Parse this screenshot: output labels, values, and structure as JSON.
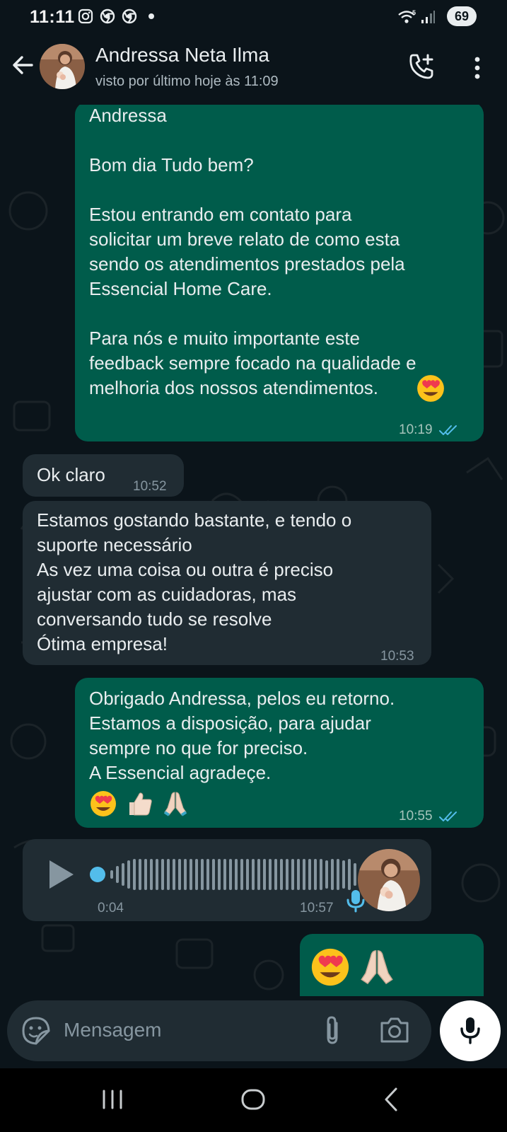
{
  "status_bar": {
    "time": "11:11",
    "battery": "69"
  },
  "header": {
    "contact_name": "Andressa Neta Ilma",
    "last_seen": "visto por último hoje às 11:09"
  },
  "messages": [
    {
      "direction": "outgoing",
      "text": "Andressa\n\nBom dia Tudo bem?\n\nEstou entrando em contato para\nsolicitar um breve relato de como esta\nsendo os atendimentos prestados pela\nEssencial Home Care.\n\nPara nós e muito importante este\nfeedback sempre focado na qualidade e\nmelhoria dos nossos atendimentos.",
      "time": "10:19",
      "status": "read"
    },
    {
      "direction": "incoming",
      "text": "Ok claro",
      "time": "10:52"
    },
    {
      "direction": "incoming",
      "text": "Estamos gostando bastante, e tendo o\nsuporte necessário\nAs vez uma coisa ou outra é preciso\najustar com as cuidadoras, mas\nconversando tudo se resolve\nÓtima empresa!",
      "time": "10:53"
    },
    {
      "direction": "outgoing",
      "text": "Obrigado Andressa, pelos eu retorno.\nEstamos a disposição, para ajudar\nsempre no que for preciso.\nA Essencial agradeçe.",
      "time": "10:55",
      "status": "read"
    },
    {
      "direction": "incoming",
      "type": "voice",
      "duration": "0:04",
      "time": "10:57"
    },
    {
      "direction": "outgoing",
      "type": "emoji-only"
    }
  ],
  "input": {
    "placeholder": "Mensagem"
  },
  "colors": {
    "background": "#0b141a",
    "outgoing_bubble": "#005c4b",
    "incoming_bubble": "#202c33",
    "read_ticks": "#53bdeb",
    "voice_accent": "#53bdeb"
  },
  "icons": [
    "arrow-back-icon",
    "add-call-icon",
    "more-vertical-icon",
    "sticker-icon",
    "attach-icon",
    "camera-icon",
    "mic-icon",
    "play-icon",
    "heart-eyes-emoji",
    "thumbs-up-emoji",
    "folded-hands-emoji"
  ]
}
